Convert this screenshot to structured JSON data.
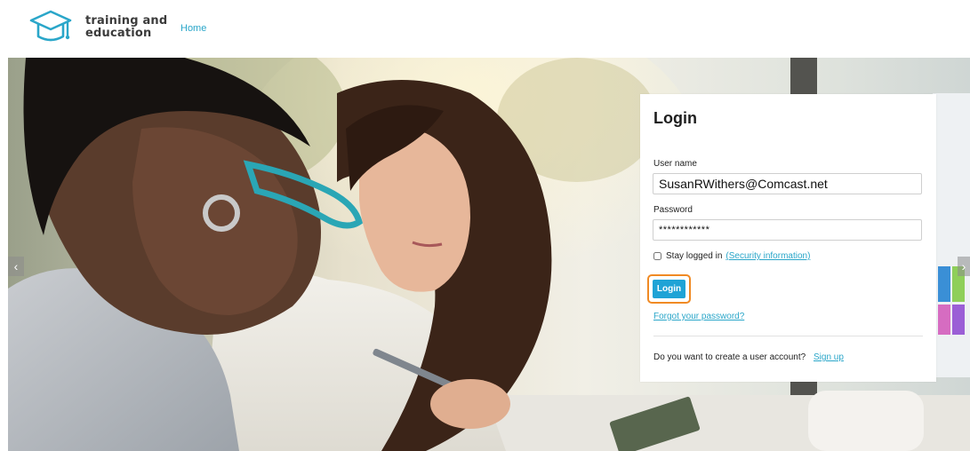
{
  "header": {
    "brand_line1": "training and",
    "brand_line2": "education",
    "nav_home": "Home",
    "logo_icon": "graduation-cap-icon",
    "brand_color": "#2aa6c9"
  },
  "hero": {
    "prev_arrow": "‹",
    "next_arrow": "›"
  },
  "login": {
    "title": "Login",
    "username_label": "User name",
    "username_value": "SusanRWithers@Comcast.net",
    "password_label": "Password",
    "password_value": "************",
    "stay_logged_in_label": "Stay logged in",
    "stay_logged_in_checked": false,
    "security_link": "(Security information)",
    "login_button": "Login",
    "forgot_link": "Forgot your password?",
    "signup_prompt": "Do you want to create a user account?",
    "signup_link": "Sign up",
    "button_color": "#1fa3d6",
    "highlight_color": "#f08a24"
  }
}
